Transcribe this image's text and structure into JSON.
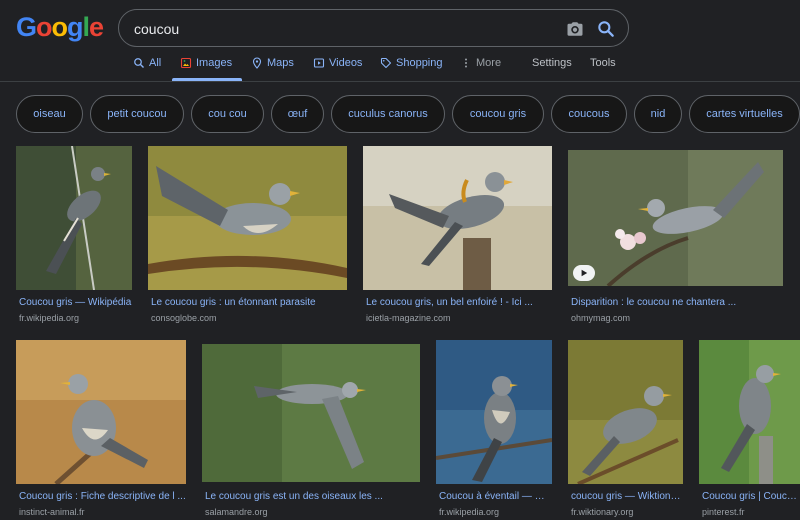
{
  "logo": {
    "letters": [
      "G",
      "o",
      "o",
      "g",
      "l",
      "e"
    ],
    "colors": [
      "#4285f4",
      "#ea4335",
      "#fbbc05",
      "#4285f4",
      "#34a853",
      "#ea4335"
    ]
  },
  "search": {
    "query": "coucou"
  },
  "tabs": [
    {
      "label": "All",
      "icon": "search-icon"
    },
    {
      "label": "Images",
      "icon": "image-icon"
    },
    {
      "label": "Maps",
      "icon": "map-pin-icon"
    },
    {
      "label": "Videos",
      "icon": "video-icon"
    },
    {
      "label": "Shopping",
      "icon": "tag-icon"
    },
    {
      "label": "More",
      "icon": "more-vert-icon"
    }
  ],
  "tools": {
    "settings": "Settings",
    "tools": "Tools"
  },
  "chips": [
    "oiseau",
    "petit coucou",
    "cou cou",
    "œuf",
    "cuculus canorus",
    "coucou gris",
    "coucous",
    "nid",
    "cartes virtuelles"
  ],
  "results": [
    {
      "title": "Coucou gris — Wikipédia",
      "source": "fr.wikipedia.org"
    },
    {
      "title": "Le coucou gris : un étonnant parasite",
      "source": "consoglobe.com"
    },
    {
      "title": "Le coucou gris, un bel enfoiré ! - Ici ...",
      "source": "icietla-magazine.com"
    },
    {
      "title": "Disparition : le coucou ne chantera ...",
      "source": "ohmymag.com"
    },
    {
      "title": "Coucou gris : Fiche descriptive de l ...",
      "source": "instinct-animal.fr"
    },
    {
      "title": "Le coucou gris est un des oiseaux les ...",
      "source": "salamandre.org"
    },
    {
      "title": "Coucou à éventail — Wi...",
      "source": "fr.wikipedia.org"
    },
    {
      "title": "coucou gris — Wiktionn...",
      "source": "fr.wiktionary.org"
    },
    {
      "title": "Coucou gris | Coucou ...",
      "source": "pinterest.fr"
    }
  ],
  "colors": {
    "accent": "#8ab4f8",
    "background": "#202124",
    "muted": "#9aa0a6"
  }
}
